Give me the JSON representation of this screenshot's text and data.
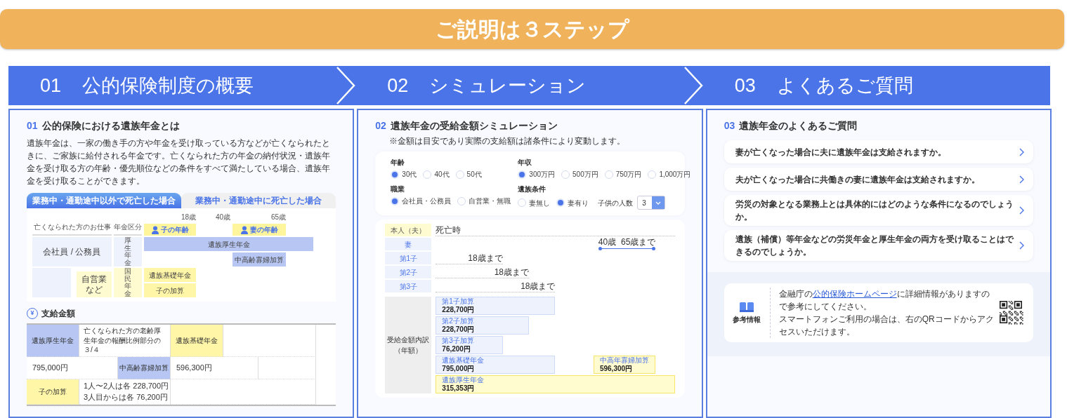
{
  "banner": {
    "title": "ご説明は３ステップ"
  },
  "steps": [
    {
      "number": "01",
      "label": "公的保険制度の概要"
    },
    {
      "number": "02",
      "label": "シミュレーション"
    },
    {
      "number": "03",
      "label": "よくあるご質問"
    }
  ],
  "overview": {
    "number": "01",
    "title": "公的保険における遺族年金とは",
    "description": "遺族年金は、一家の働き手の方や年金を受け取っている方などが亡くなられたときに、ご家族に給付される年金です。亡くなられた方の年金の納付状況・遺族年金を受け取る方の年齢・優先順位などの条件をすべて満たしている場合、遺族年金を受け取ることができます。",
    "tabs": [
      {
        "label": "業務中・通勤途中以外で死亡した場合",
        "selected": true
      },
      {
        "label": "業務中・通勤途中に死亡した場合",
        "selected": false
      }
    ],
    "diagram": {
      "headers": [
        "亡くなられた方のお仕事",
        "年金区分"
      ],
      "ticks": [
        "18歳",
        "40歳",
        "65歳"
      ],
      "ages": [
        "子の年齢",
        "妻の年齢"
      ],
      "jobs": [
        "会社員 / 公務員",
        "自営業など"
      ],
      "categories": [
        "厚生年金",
        "国民年金"
      ],
      "bars": [
        {
          "label": "遺族厚生年金",
          "kind": "employee"
        },
        {
          "label": "中高齢寡婦加算",
          "kind": "employee"
        },
        {
          "label": "遺族基礎年金",
          "kind": "basic"
        },
        {
          "label": "子の加算",
          "kind": "basic"
        }
      ]
    },
    "amounts": {
      "icon": "¥",
      "title": "支給金額",
      "cells": [
        {
          "kind": "employee",
          "text": "遺族厚生年金"
        },
        {
          "kind": "text",
          "text": "亡くなられた方の老齢厚生年金の報酬比例部分の３/４"
        },
        {
          "kind": "basic",
          "text": "遺族基礎年金"
        },
        {
          "kind": "amount",
          "text": "795,000円"
        },
        {
          "kind": "employee",
          "text": "中高齢寡婦加算"
        },
        {
          "kind": "amount",
          "text": "596,300円"
        },
        {
          "kind": "basic",
          "text": "子の加算"
        },
        {
          "kind": "lines",
          "lines": [
            "1人〜2人は各 228,700円",
            "3人目からは各 76,200円"
          ]
        }
      ]
    }
  },
  "simulation": {
    "number": "02",
    "title": "遺族年金の受給金額シミュレーション",
    "note": "※金額は目安であり実際の支給額は諸条件により変動します。",
    "form": [
      {
        "label": "年齢",
        "options": [
          {
            "label": "30代",
            "selected": true
          },
          {
            "label": "40代",
            "selected": false
          },
          {
            "label": "50代",
            "selected": false
          }
        ]
      },
      {
        "label": "年収",
        "options": [
          {
            "label": "300万円",
            "selected": true
          },
          {
            "label": "500万円",
            "selected": false
          },
          {
            "label": "750万円",
            "selected": false
          },
          {
            "label": "1,000万円",
            "selected": false
          }
        ]
      },
      {
        "label": "職業",
        "options": [
          {
            "label": "会社員・公務員",
            "selected": true
          },
          {
            "label": "自営業・無職",
            "selected": false
          }
        ]
      },
      {
        "label": "遺族条件",
        "options": [
          {
            "label": "妻無し",
            "selected": false
          },
          {
            "label": "妻有り",
            "selected": true
          }
        ],
        "count": {
          "label": "子供の人数",
          "value": "3"
        }
      }
    ],
    "timeline": [
      {
        "label": "本人（夫）",
        "kind": "death",
        "text": "死亡時"
      },
      {
        "label": "妻",
        "kind": "wife",
        "start": "40歳",
        "end": "65歳まで"
      },
      {
        "label": "第1子",
        "kind": "child",
        "text": "18歳まで"
      },
      {
        "label": "第2子",
        "kind": "child",
        "text": "18歳まで"
      },
      {
        "label": "第3子",
        "kind": "child",
        "text": "18歳まで"
      }
    ],
    "breakdown": {
      "label": "受給金額内訳（年額）",
      "items": [
        {
          "name": "第1子加算",
          "amount": "228,700円",
          "kind": "child"
        },
        {
          "name": "第2子加算",
          "amount": "228,700円",
          "kind": "child"
        },
        {
          "name": "第3子加算",
          "amount": "76,200円",
          "kind": "child"
        },
        {
          "name": "遺族基礎年金",
          "amount": "795,000円",
          "kind": "basic"
        },
        {
          "name": "中高年寡婦加算",
          "amount": "596,300円",
          "kind": "widow"
        },
        {
          "name": "遺族厚生年金",
          "amount": "315,353円",
          "kind": "employee"
        }
      ]
    }
  },
  "faq": {
    "number": "03",
    "title": "遺族年金のよくあるご質問",
    "questions": [
      "妻が亡くなった場合に夫に遺族年金は支給されますか。",
      "夫が亡くなった場合に共働きの妻に遺族年金は支給されますか。",
      "労災の対象となる業務上とは具体的にはどのような条件になるのでしょうか。",
      "遺族（補償）等年金などの労災年金と厚生年金の両方を受け取ることはできるのでしょうか。"
    ],
    "reference": {
      "label": "参考情報",
      "before": "金融庁の",
      "link": "公的保険ホームページ",
      "after": "に詳細情報がありますので参考にしてください。",
      "line2": "スマートフォンご利用の場合は、右のQRコードからアクセスいただけます。"
    }
  }
}
